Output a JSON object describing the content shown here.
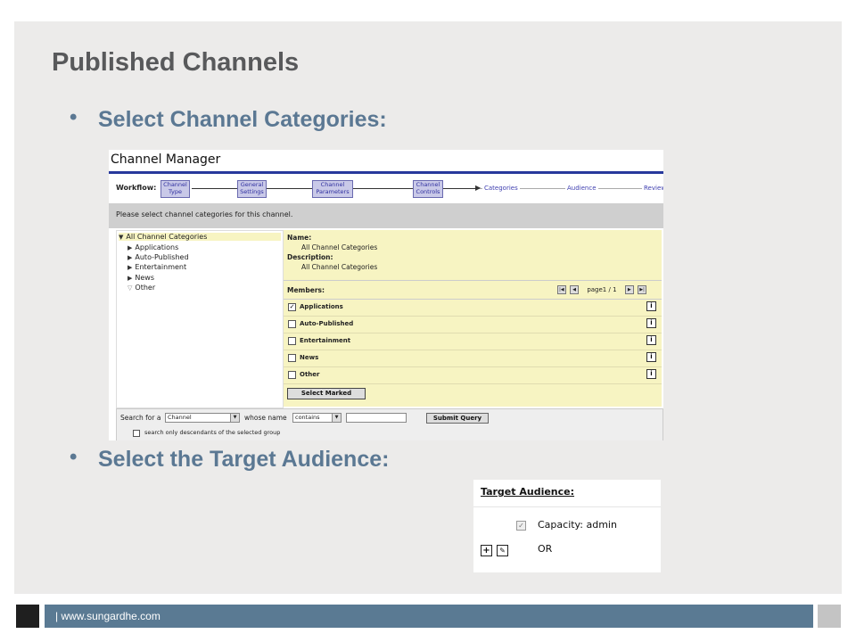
{
  "slide": {
    "title": "Published Channels",
    "bullet1": "Select Channel Categories:",
    "bullet2": "Select the Target Audience:",
    "bullet_glyph": "•"
  },
  "channel_manager": {
    "title": "Channel Manager",
    "workflow_label": "Workflow:",
    "steps": [
      {
        "line1": "Channel",
        "line2": "Type"
      },
      {
        "line1": "General",
        "line2": "Settings"
      },
      {
        "line1": "Channel",
        "line2": "Parameters"
      },
      {
        "line1": "Channel",
        "line2": "Controls"
      }
    ],
    "next_steps": [
      "Categories",
      "Audience",
      "Review"
    ],
    "instruction": "Please select channel categories for this channel.",
    "tree": [
      {
        "label": "All Channel Categories",
        "selected": true
      },
      {
        "label": "Applications"
      },
      {
        "label": "Auto-Published"
      },
      {
        "label": "Entertainment"
      },
      {
        "label": "News"
      },
      {
        "label": "Other"
      }
    ],
    "name_label": "Name:",
    "name_value": "All Channel Categories",
    "description_label": "Description:",
    "description_value": "All Channel Categories",
    "members_label": "Members:",
    "pager_text": "page1 / 1",
    "members": [
      {
        "label": "Applications",
        "checked": true
      },
      {
        "label": "Auto-Published",
        "checked": false
      },
      {
        "label": "Entertainment",
        "checked": false
      },
      {
        "label": "News",
        "checked": false
      },
      {
        "label": "Other",
        "checked": false
      }
    ],
    "info_icon": "i",
    "select_marked": "Select Marked",
    "search": {
      "prefix": "Search for a",
      "type_value": "Channel",
      "whose_name": "whose name",
      "operator_value": "contains",
      "query_value": "",
      "submit": "Submit Query",
      "descendants_label": "search only descendants of the selected group"
    }
  },
  "target_audience": {
    "title": "Target Audience:",
    "capacity_text": "Capacity: admin",
    "or_text": "OR",
    "add_glyph": "+",
    "edit_glyph": "✎"
  },
  "footer": {
    "text": "| www.sungardhe.com"
  },
  "colors": {
    "bullet_blue": "#5b7893",
    "footer_blue": "#5a7a93",
    "panel_yellow": "#f7f4c2"
  }
}
